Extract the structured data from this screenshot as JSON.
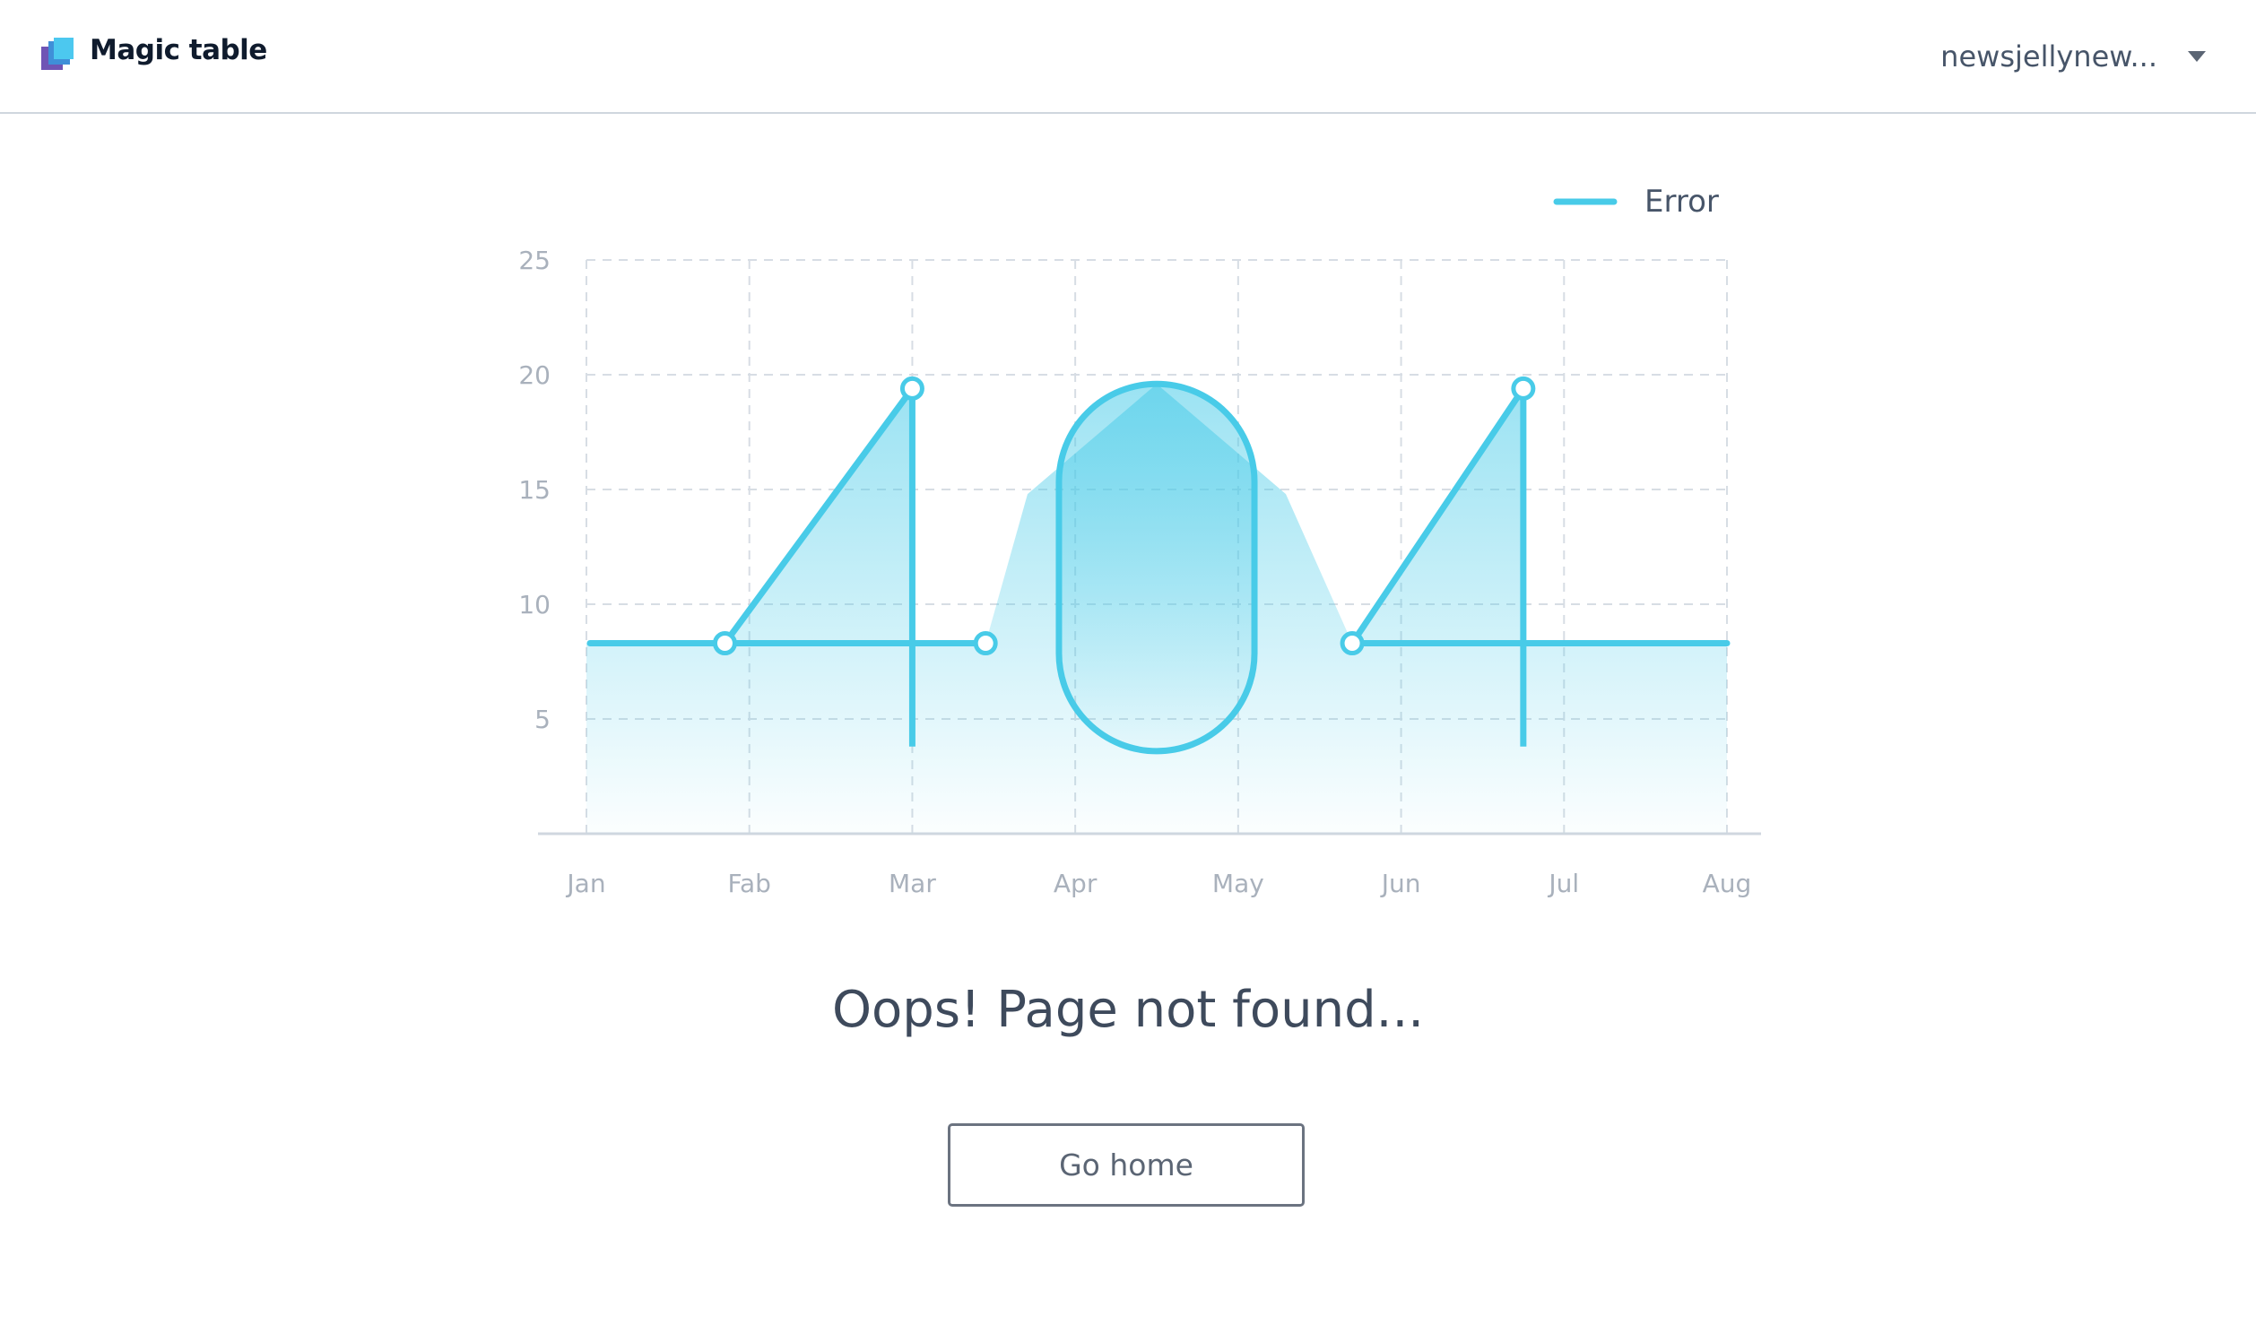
{
  "header": {
    "app_name": "Magic table",
    "account_name": "newsjellynew..."
  },
  "main": {
    "title": "Oops! Page not found...",
    "home_button_label": "Go home"
  },
  "colors": {
    "accent": "#48cbe8",
    "grid": "#d7dde4",
    "tick_text": "#a9b1bc"
  },
  "chart_data": {
    "type": "line",
    "legend": [
      "Error"
    ],
    "legend_position": "top-right",
    "grid": true,
    "categories": [
      "Jan",
      "Fab",
      "Mar",
      "Apr",
      "May",
      "Jun",
      "Jul",
      "Aug"
    ],
    "y_ticks": [
      25,
      20,
      15,
      10,
      5
    ],
    "ylim": [
      0,
      25
    ],
    "xlim": [
      0,
      7
    ],
    "series": [
      {
        "name": "Error",
        "shape": "404",
        "baseline": 8.3,
        "points": [
          {
            "x": 0.85,
            "y": 8.3
          },
          {
            "x": 2.0,
            "y": 19.4
          },
          {
            "x": 2.45,
            "y": 8.3
          },
          {
            "x": 4.7,
            "y": 8.3
          },
          {
            "x": 5.75,
            "y": 19.4
          }
        ],
        "vertical_strokes": [
          {
            "x": 2.0,
            "y_from": 19.4,
            "y_to": 3.8
          },
          {
            "x": 5.75,
            "y_from": 19.4,
            "y_to": 3.8
          }
        ],
        "zero_capsule": {
          "x_from": 2.9,
          "x_to": 4.1,
          "y_from": 3.6,
          "y_to": 19.6
        }
      }
    ]
  }
}
